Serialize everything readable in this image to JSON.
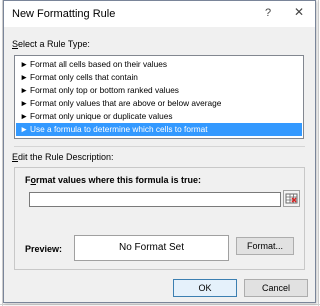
{
  "dialog": {
    "title": "New Formatting Rule",
    "help_glyph": "?",
    "close_glyph": "✕"
  },
  "rule_type": {
    "label_prefix": "S",
    "label_rest": "elect a Rule Type:",
    "items": [
      {
        "label": "Format all cells based on their values",
        "selected": false
      },
      {
        "label": "Format only cells that contain",
        "selected": false
      },
      {
        "label": "Format only top or bottom ranked values",
        "selected": false
      },
      {
        "label": "Format only values that are above or below average",
        "selected": false
      },
      {
        "label": "Format only unique or duplicate values",
        "selected": false
      },
      {
        "label": "Use a formula to determine which cells to format",
        "selected": true
      }
    ],
    "arrow": "►"
  },
  "rule_description": {
    "label_prefix": "E",
    "label_rest": "dit the Rule Description:",
    "formula_label_prefix": "F",
    "formula_label_mid": "o",
    "formula_label_rest": "rmat values where this formula is true:",
    "formula_value": ""
  },
  "preview": {
    "label": "Preview:",
    "text": "No Format Set"
  },
  "buttons": {
    "format": "Format...",
    "ok": "OK",
    "cancel": "Cancel"
  },
  "colors": {
    "selection": "#3399ff",
    "dialog_bg": "#f0f0f0"
  }
}
